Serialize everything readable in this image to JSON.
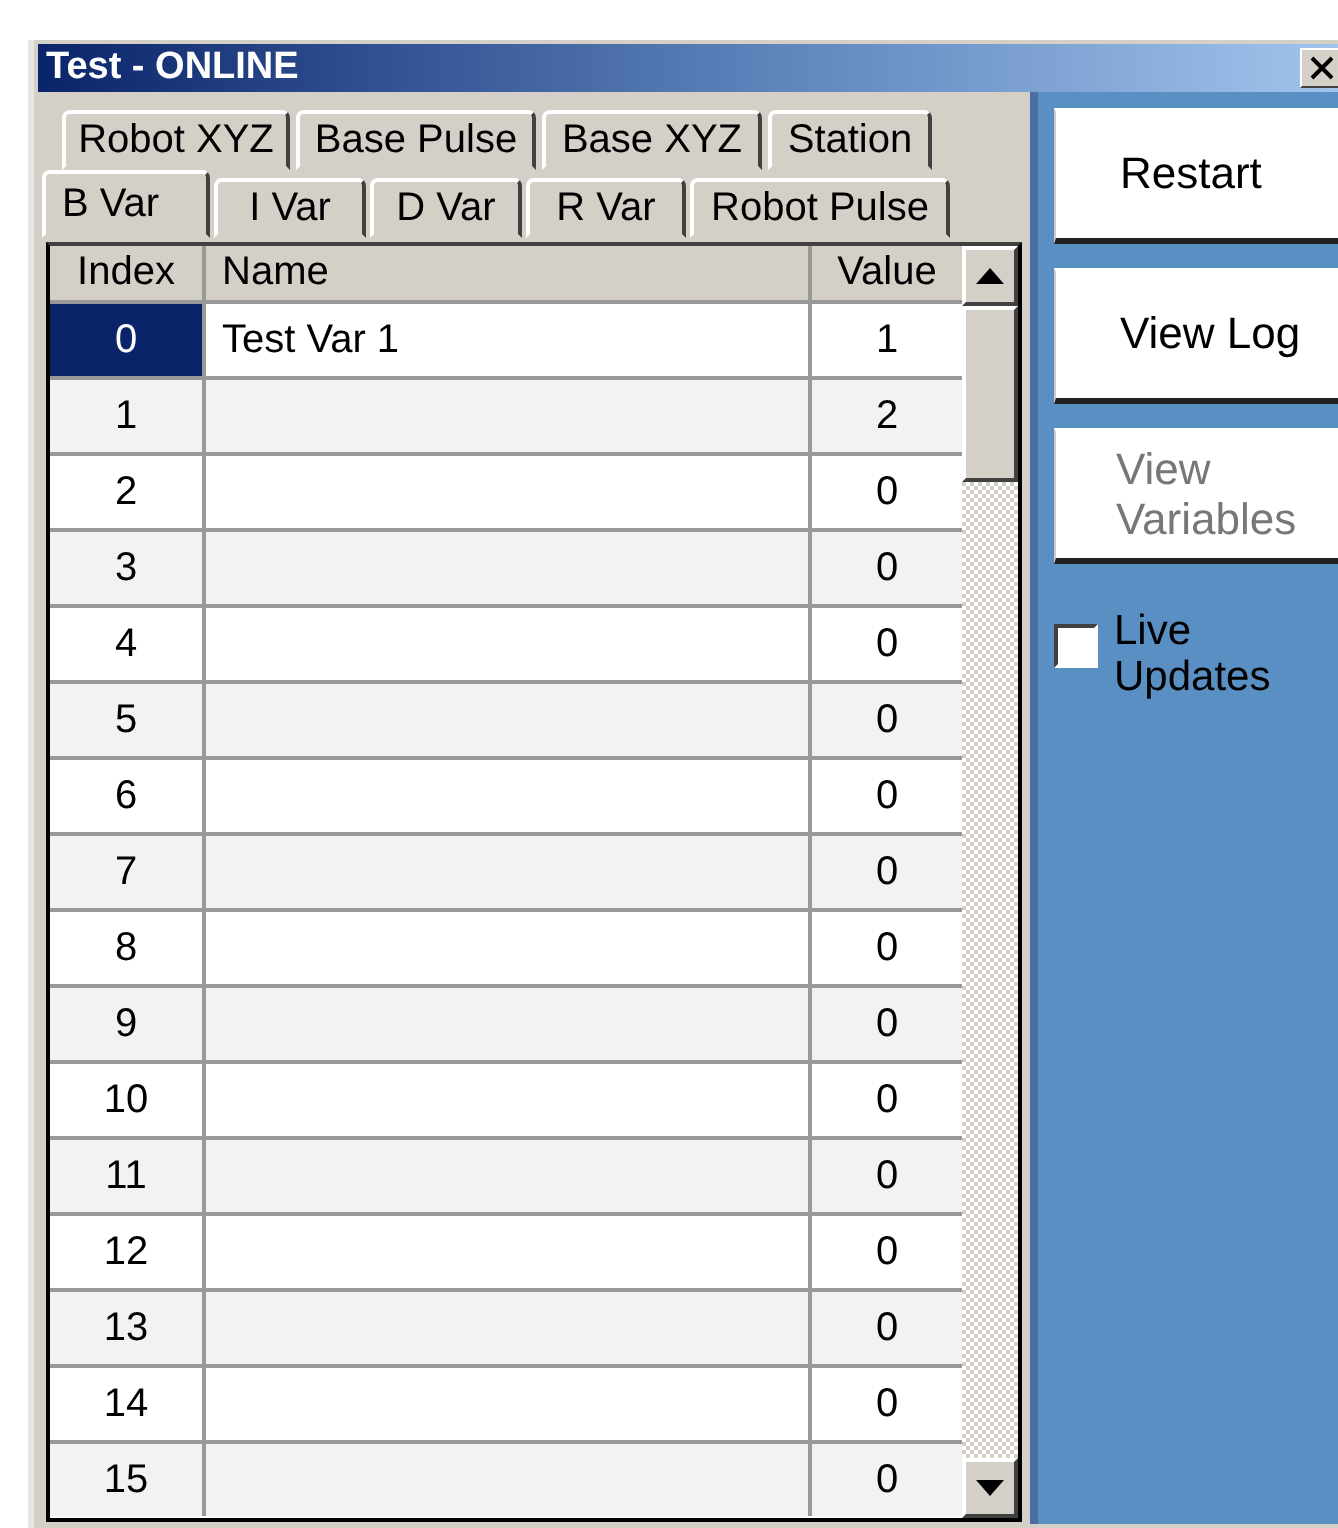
{
  "window": {
    "title": "Test - ONLINE"
  },
  "tab_rows": [
    [
      {
        "label": "Robot XYZ",
        "selected": false
      },
      {
        "label": "Base Pulse",
        "selected": false
      },
      {
        "label": "Base XYZ",
        "selected": false
      },
      {
        "label": "Station",
        "selected": false
      }
    ],
    [
      {
        "label": "B Var",
        "selected": true
      },
      {
        "label": "I Var",
        "selected": false
      },
      {
        "label": "D Var",
        "selected": false
      },
      {
        "label": "R Var",
        "selected": false
      },
      {
        "label": "Robot Pulse",
        "selected": false
      }
    ]
  ],
  "table": {
    "columns": [
      "Index",
      "Name",
      "Value"
    ],
    "rows": [
      {
        "index": "0",
        "name": "Test Var 1",
        "value": "1",
        "selected": true
      },
      {
        "index": "1",
        "value": "2",
        "selected": false
      },
      {
        "index": "2",
        "value": "0",
        "selected": false
      },
      {
        "index": "3",
        "value": "0",
        "selected": false
      },
      {
        "index": "4",
        "value": "0",
        "selected": false
      },
      {
        "index": "5",
        "value": "0",
        "selected": false
      },
      {
        "index": "6",
        "value": "0",
        "selected": false
      },
      {
        "index": "7",
        "value": "0",
        "selected": false
      },
      {
        "index": "8",
        "value": "0",
        "selected": false
      },
      {
        "index": "9",
        "value": "0",
        "selected": false
      },
      {
        "index": "10",
        "value": "0",
        "selected": false
      },
      {
        "index": "11",
        "value": "0",
        "selected": false
      },
      {
        "index": "12",
        "value": "0",
        "selected": false
      },
      {
        "index": "13",
        "value": "0",
        "selected": false
      },
      {
        "index": "14",
        "value": "0",
        "selected": false
      },
      {
        "index": "15",
        "value": "0",
        "selected": false
      }
    ]
  },
  "buttons": [
    {
      "label": "Restart",
      "disabled": false
    },
    {
      "label": "View Log",
      "disabled": false
    },
    {
      "label": "View\nVariables",
      "disabled": true
    }
  ],
  "live_updates": {
    "label": "Live\nUpdates",
    "checked": false
  }
}
